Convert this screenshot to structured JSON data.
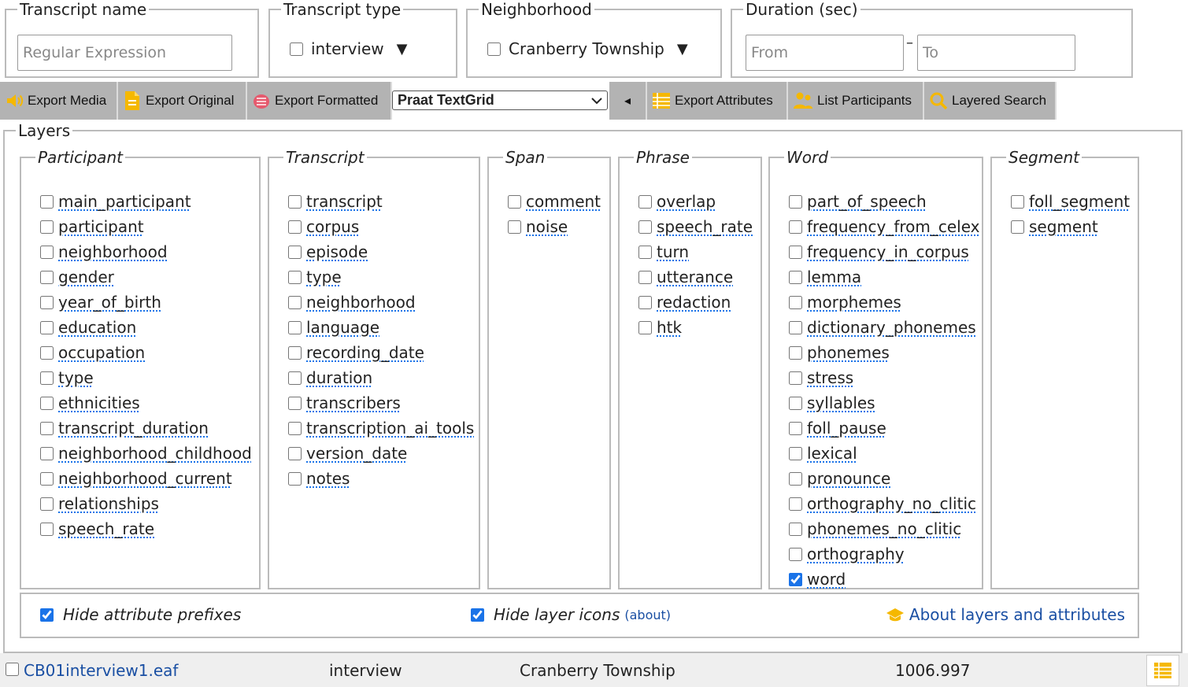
{
  "filters": {
    "transcript_name": {
      "legend": "Transcript name",
      "placeholder": "Regular Expression"
    },
    "transcript_type": {
      "legend": "Transcript type",
      "option": "interview",
      "caret": "▼"
    },
    "neighborhood": {
      "legend": "Neighborhood",
      "option": "Cranberry Township",
      "caret": "▼"
    },
    "duration": {
      "legend": "Duration (sec)",
      "from_placeholder": "From",
      "separator": "–",
      "to_placeholder": "To"
    }
  },
  "toolbar": {
    "export_media": "Export Media",
    "export_original": "Export Original",
    "export_formatted": "Export Formatted",
    "format_selected": "Praat TextGrid",
    "collapse_caret": "◂",
    "export_attributes": "Export Attributes",
    "list_participants": "List Participants",
    "layered_search": "Layered Search"
  },
  "layers": {
    "legend": "Layers",
    "groups": [
      {
        "legend": "Participant",
        "items": [
          "main_participant",
          "participant",
          "neighborhood",
          "gender",
          "year_of_birth",
          "education",
          "occupation",
          "type",
          "ethnicities",
          "transcript_duration",
          "neighborhood_childhood",
          "neighborhood_current",
          "relationships",
          "speech_rate"
        ]
      },
      {
        "legend": "Transcript",
        "items": [
          "transcript",
          "corpus",
          "episode",
          "type",
          "neighborhood",
          "language",
          "recording_date",
          "duration",
          "transcribers",
          "transcription_ai_tools",
          "version_date",
          "notes"
        ]
      },
      {
        "legend": "Span",
        "items": [
          "comment",
          "noise"
        ]
      },
      {
        "legend": "Phrase",
        "items": [
          "overlap",
          "speech_rate",
          "turn",
          "utterance",
          "redaction",
          "htk"
        ]
      },
      {
        "legend": "Word",
        "items": [
          "part_of_speech",
          "frequency_from_celex",
          "frequency_in_corpus",
          "lemma",
          "morphemes",
          "dictionary_phonemes",
          "phonemes",
          "stress",
          "syllables",
          "foll_pause",
          "lexical",
          "pronounce",
          "orthography_no_clitic",
          "phonemes_no_clitic",
          "orthography",
          "word"
        ],
        "checked": [
          "word"
        ]
      },
      {
        "legend": "Segment",
        "items": [
          "foll_segment",
          "segment"
        ]
      }
    ],
    "options": {
      "hide_attribute_prefixes": "Hide attribute prefixes",
      "hide_layer_icons": "Hide layer icons",
      "about_paren": "(about)",
      "about_link": "About layers and attributes"
    }
  },
  "results": {
    "row": {
      "name": "CB01interview1.eaf",
      "type": "interview",
      "neighborhood": "Cranberry Township",
      "duration": "1006.997"
    }
  },
  "colors": {
    "accent": "#1a73e8",
    "toolbar_bg": "#b3b3b3",
    "icon_gold": "#f5b800",
    "link": "#1a4fa3"
  }
}
